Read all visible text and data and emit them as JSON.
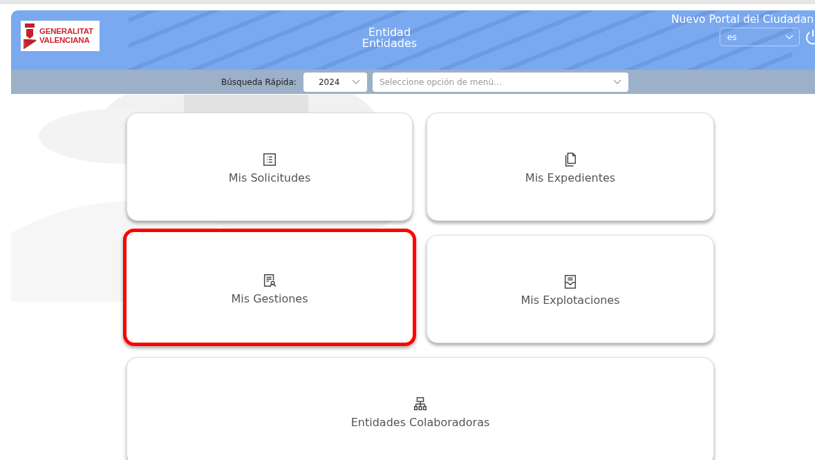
{
  "header": {
    "logo": {
      "line_1": "GENERALITAT",
      "line_2": "VALENCIANA"
    },
    "title": "Entidad",
    "subtitle": "Entidades",
    "portal_name": "Nuevo Portal del Ciudadan",
    "language": "es"
  },
  "quick_search": {
    "label": "Búsqueda Rápida:",
    "year": "2024",
    "menu_placeholder": "Seleccione opción de menú..."
  },
  "cards": [
    {
      "kind": "solicitudes",
      "label": "Mis Solicitudes",
      "highlighted": false,
      "wide": false
    },
    {
      "kind": "expedientes",
      "label": "Mis Expedientes",
      "highlighted": false,
      "wide": false
    },
    {
      "kind": "gestiones",
      "label": "Mis Gestiones",
      "highlighted": true,
      "wide": false
    },
    {
      "kind": "explotaciones",
      "label": "Mis Explotaciones",
      "highlighted": false,
      "wide": false
    },
    {
      "kind": "colaboradoras",
      "label": "Entidades Colaboradoras",
      "highlighted": false,
      "wide": true
    }
  ]
}
